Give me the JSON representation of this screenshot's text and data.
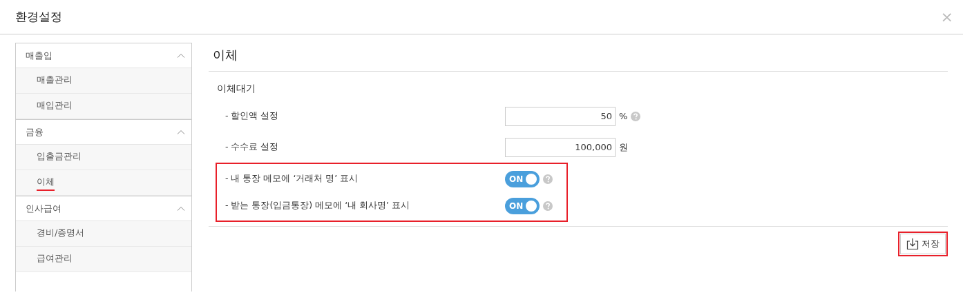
{
  "dialog": {
    "title": "환경설정",
    "close_label": "×"
  },
  "sidebar": {
    "groups": [
      {
        "label": "매출입",
        "expanded": true,
        "items": [
          {
            "label": "매출관리",
            "selected": false
          },
          {
            "label": "매입관리",
            "selected": false
          }
        ]
      },
      {
        "label": "금융",
        "expanded": true,
        "items": [
          {
            "label": "입출금관리",
            "selected": false
          },
          {
            "label": "이체",
            "selected": true
          }
        ]
      },
      {
        "label": "인사급여",
        "expanded": true,
        "items": [
          {
            "label": "경비/증명서",
            "selected": false
          },
          {
            "label": "급여관리",
            "selected": false
          }
        ]
      }
    ]
  },
  "content": {
    "title": "이체",
    "section": "이체대기",
    "rows": [
      {
        "kind": "input",
        "label": "- 할인액 설정",
        "value": "50",
        "unit": "%",
        "help": true,
        "highlighted": false
      },
      {
        "kind": "input",
        "label": "- 수수료 설정",
        "value": "100,000",
        "unit": "원",
        "help": false,
        "highlighted": false
      },
      {
        "kind": "toggle",
        "label": "- 내 통장 메모에 ‘거래처 명’ 표시",
        "on": true,
        "toggle_text": "ON",
        "help": true,
        "highlighted": true
      },
      {
        "kind": "toggle",
        "label": "- 받는 통장(입금통장) 메모에 ‘내 회사명’ 표시",
        "on": true,
        "toggle_text": "ON",
        "help": true,
        "highlighted": true
      }
    ]
  },
  "save_button": {
    "label": "저장",
    "highlighted": true
  }
}
